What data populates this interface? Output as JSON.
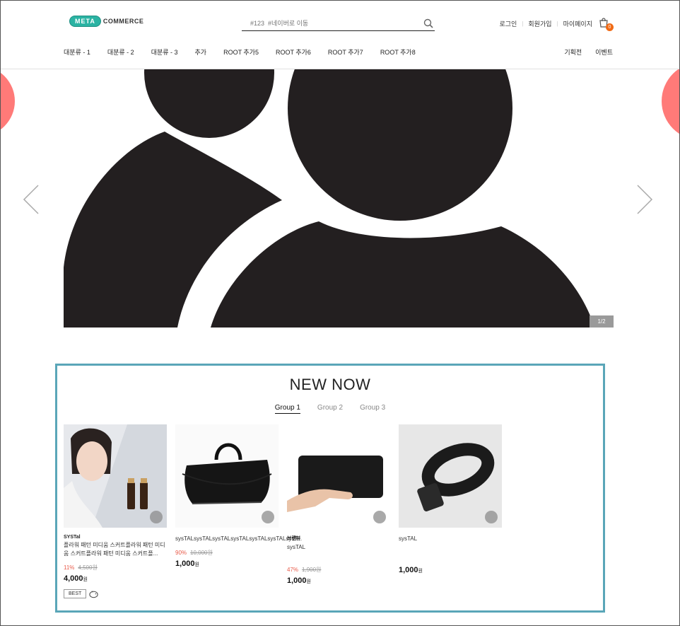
{
  "header": {
    "logo_badge": "META",
    "logo_text": "COMMERCE",
    "search_placeholder": "#123  #네이버로 이동",
    "util": [
      "로그인",
      "회원가입",
      "마이페이지"
    ],
    "cart_count": "0"
  },
  "nav": {
    "left": [
      "대분류 - 1",
      "대분류 - 2",
      "대분류 - 3",
      "추가",
      "ROOT 추가5",
      "ROOT 추가6",
      "ROOT 추가7",
      "ROOT 추가8"
    ],
    "right": [
      "기획전",
      "이벤트"
    ]
  },
  "banner": {
    "pager": "1/2"
  },
  "new_now": {
    "title": "NEW NOW",
    "tabs": [
      "Group 1",
      "Group 2",
      "Group 3"
    ],
    "products": [
      {
        "brand": "SYSTal",
        "name": "플라워 패턴 미디움 스커트플라워 패턴 미디움 스커트플라워 패턴 미디움 스커트플...",
        "pct": "11%",
        "orig": "4,500원",
        "price": "4,000",
        "won": "원",
        "tag": "BEST"
      },
      {
        "brand": "",
        "name": "sysTALsysTALsysTALsysTALsysTALsysTALsysT...",
        "pct": "90%",
        "orig": "10,000원",
        "price": "1,000",
        "won": "원"
      },
      {
        "brand": "브랜뷰",
        "name": "sysTAL",
        "pct": "47%",
        "orig": "1,900원",
        "price": "1,000",
        "won": "원"
      },
      {
        "brand": "",
        "name": "sysTAL",
        "pct": "",
        "orig": "",
        "price": "1,000",
        "won": "원"
      }
    ]
  },
  "colors": {
    "accent": "#5aa6b8",
    "sale": "#e85b4a",
    "cart_badge": "#f06a15",
    "banner_side": "#ff7a78"
  }
}
